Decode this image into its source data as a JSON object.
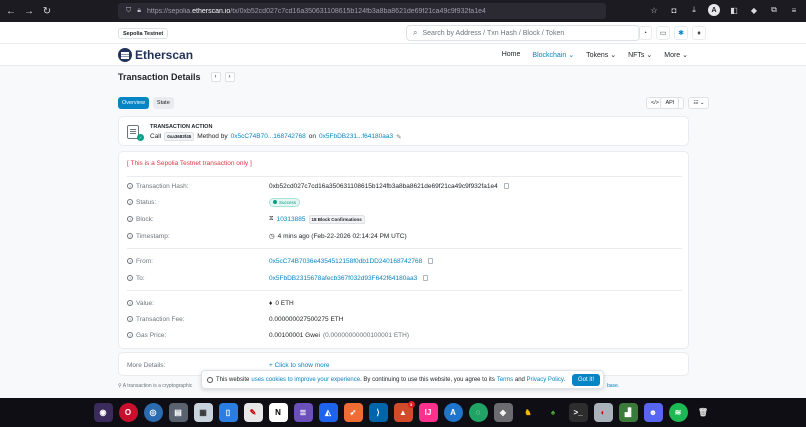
{
  "browser": {
    "url_prefix": "https://sepolia.",
    "url_domain": "etherscan.io",
    "url_suffix": "/tx/0xb52cd027c7cd16a350631108615b124fb3a8ba8621de69f21ca49c9f932fa1e4"
  },
  "header": {
    "network_badge": "Sepolia Testnet",
    "search_placeholder": "Search by Address / Txn Hash / Block / Token"
  },
  "nav": {
    "logo": "Etherscan",
    "items": [
      "Home",
      "Blockchain",
      "Tokens",
      "NFTs",
      "More"
    ]
  },
  "page": {
    "title": "Transaction Details",
    "tabs": [
      "Overview",
      "State"
    ],
    "api_label": "API"
  },
  "action": {
    "title": "TRANSACTION ACTION",
    "call": "Call",
    "method_id": "0xa3683f45",
    "method_by": "Method by",
    "from_short": "0x5cC74B70...168742768",
    "on": "on",
    "to_short": "0x5FbDB231...f64180aa3"
  },
  "details": {
    "testnet_notice_prefix": "[ This is a Sepolia ",
    "testnet_notice_word": "Testnet",
    "testnet_notice_suffix": " transaction only ]",
    "hash_label": "Transaction Hash:",
    "hash_value": "0xb52cd027c7cd16a350631108615b124fb3a8ba8621de69f21ca49c9f932fa1e4",
    "status_label": "Status:",
    "status_value": "Success",
    "block_label": "Block:",
    "block_value": "10313885",
    "block_confirmations": "18 Block Confirmations",
    "timestamp_label": "Timestamp:",
    "timestamp_value": "4 mins ago (Feb-22-2026 02:14:24 PM UTC)",
    "from_label": "From:",
    "from_value": "0x5cC74B7036e4354512158f0db1DD240168742768",
    "to_label": "To:",
    "to_value": "0x5FbDB2315678afecb367f032d93F642f64180aa3",
    "value_label": "Value:",
    "value_value": "0 ETH",
    "fee_label": "Transaction Fee:",
    "fee_value": "0.000000027500275 ETH",
    "gas_label": "Gas Price:",
    "gas_value": "0.00100001 Gwei",
    "gas_eth": "(0.00000000000100001 ETH)"
  },
  "more": {
    "label": "More Details:",
    "action": "+ Click to show more"
  },
  "footnote": {
    "text": "A transaction is a cryptographic",
    "tail": "base."
  },
  "cookie": {
    "prefix": "This website ",
    "link1": "uses cookies to improve your experience",
    "middle": ". By continuing to use this website, you agree to its ",
    "link2": "Terms",
    "and": " and ",
    "link3": "Privacy Policy",
    "end": ".",
    "button": "Got it!"
  },
  "colors": {
    "accent": "#0784c3",
    "success": "#00a186",
    "danger": "#dc3545",
    "taskbar": "#0e0e14"
  }
}
